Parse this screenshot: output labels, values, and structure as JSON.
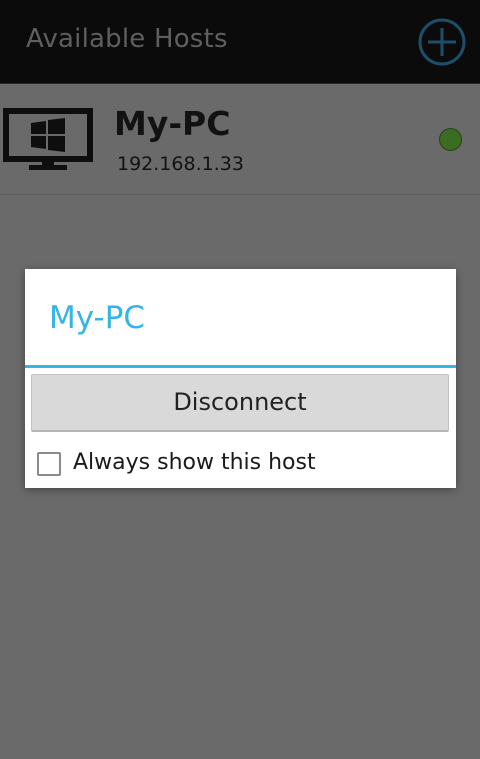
{
  "action_bar": {
    "title": "Available Hosts",
    "add_icon": "add-circle-icon"
  },
  "hosts": [
    {
      "name": "My-PC",
      "ip": "192.168.1.33",
      "icon": "windows-monitor-icon",
      "status_color": "#3a6d22"
    }
  ],
  "dialog": {
    "title": "My-PC",
    "primary_button_label": "Disconnect",
    "checkbox_label": "Always show this host",
    "checkbox_checked": false
  },
  "colors": {
    "accent": "#33b5e5",
    "action_bar_bg": "#0b0b0b",
    "dim_background": "#6a6a6a"
  }
}
